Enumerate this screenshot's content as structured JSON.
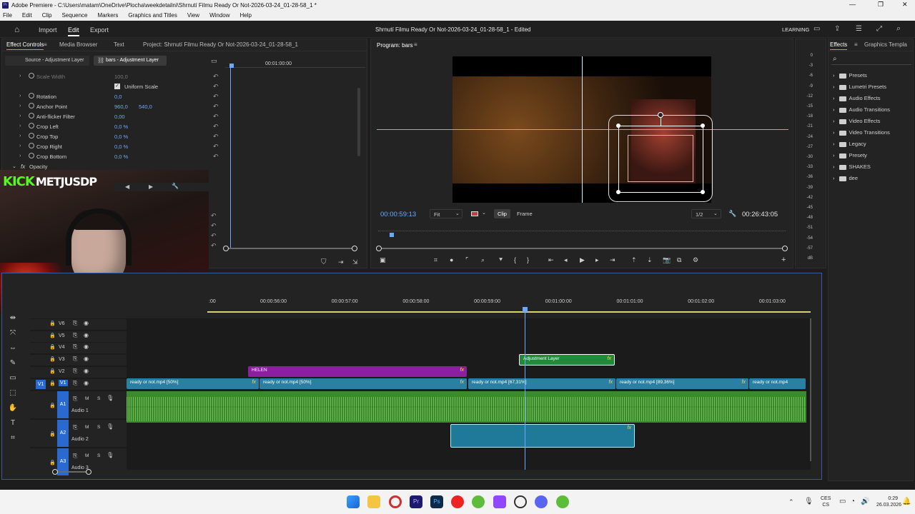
{
  "window": {
    "title": "Adobe Premiere - C:\\Users\\matam\\OneDrive\\Plocha\\weekdetailni\\Shrnutí Filmu Ready Or Not-2026-03-24_01-28-58_1 *"
  },
  "menu": [
    "File",
    "Edit",
    "Clip",
    "Sequence",
    "Markers",
    "Graphics and Titles",
    "View",
    "Window",
    "Help"
  ],
  "workspace": {
    "tabs": [
      "Import",
      "Edit",
      "Export"
    ],
    "active_tab": "Edit",
    "project_title": "Shrnutí Filmu Ready Or Not-2026-03-24_01-28-58_1",
    "edited": "- Edited",
    "learning": "LEARNING"
  },
  "effect_controls": {
    "tabs": [
      "Effect Controls",
      "Media Browser",
      "Text",
      "Project: Shrnutí Filmu Ready Or Not-2026-03-24_01-28-58_1"
    ],
    "source_label": "Source - Adjustment Layer",
    "clip_label": "bars - Adjustment Layer",
    "timecode": "00:01:00:00",
    "properties": [
      {
        "name": "Scale Width",
        "v1": "100,0",
        "v2": "",
        "dim": true
      },
      {
        "name": "Uniform Scale",
        "v1": "",
        "v2": "",
        "checkbox": true
      },
      {
        "name": "Rotation",
        "v1": "0,0",
        "v2": ""
      },
      {
        "name": "Anchor Point",
        "v1": "960,0",
        "v2": "540,0"
      },
      {
        "name": "Anti-flicker Filter",
        "v1": "0,00",
        "v2": ""
      },
      {
        "name": "Crop Left",
        "v1": "0,0 %",
        "v2": ""
      },
      {
        "name": "Crop Top",
        "v1": "0,0 %",
        "v2": ""
      },
      {
        "name": "Crop Right",
        "v1": "0,0 %",
        "v2": ""
      },
      {
        "name": "Crop Bottom",
        "v1": "0,0 %",
        "v2": ""
      }
    ],
    "opacity_label": "Opacity"
  },
  "overlay": {
    "kick_text": "KICK",
    "channel": "METJUSDP"
  },
  "program_monitor": {
    "title": "Program: bars",
    "current_tc": "00:00:59:13",
    "fit": "Fit",
    "clip_btn": "Clip",
    "frame_btn": "Frame",
    "resolution": "1/2",
    "duration_tc": "00:26:43:05"
  },
  "audio_meter": {
    "labels": [
      "0",
      "-3",
      "-6",
      "-9",
      "-12",
      "-15",
      "-18",
      "-21",
      "-24",
      "-27",
      "-30",
      "-33",
      "-36",
      "-39",
      "-42",
      "-45",
      "-48",
      "-51",
      "-54",
      "-57",
      "dB"
    ]
  },
  "effects_panel": {
    "tabs": [
      "Effects",
      "Graphics Templa"
    ],
    "items": [
      "Presets",
      "Lumetri Presets",
      "Audio Effects",
      "Audio Transitions",
      "Video Effects",
      "Video Transitions",
      "Legacy",
      "Presety",
      "SHAKES",
      "dee"
    ]
  },
  "timeline": {
    "ruler": [
      "00:00:56:00",
      "00:00:57:00",
      "00:00:58:00",
      "00:00:59:00",
      "00:01:00:00",
      "00:01:01:00",
      "00:01:02:00",
      "00:01:03:00"
    ],
    "ruler_start": ":00",
    "video_tracks": [
      "V6",
      "V5",
      "V4",
      "V3",
      "V2",
      "V1"
    ],
    "audio_tracks": [
      {
        "id": "A1",
        "name": "Audio 1"
      },
      {
        "id": "A2",
        "name": "Audio 2"
      },
      {
        "id": "A3",
        "name": "Audio 3"
      }
    ],
    "track_btn_m": "M",
    "track_btn_s": "S",
    "source_patch": "V1",
    "clips": {
      "adjustment": "Adjustment Layer",
      "helen": "HELEN",
      "v1": [
        "ready or not.mp4 [50%]",
        "ready or not.mp4 [50%]",
        "ready or not.mp4 [67,31%]",
        "ready or not.mp4 [89,36%]",
        "ready or not.mp4"
      ],
      "fx": "fx"
    }
  },
  "taskbar": {
    "lang1": "CES",
    "lang2": "CS",
    "time": "0:29",
    "date": "26.03.2026"
  },
  "colors": {
    "accent": "#6aa8ff",
    "v1_clip": "#2b7fa3",
    "helen_clip": "#8c1fa0",
    "adjustment_clip": "#1f8a3a",
    "audio_clip": "#3a8c2a",
    "playhead": "#6aa8ff"
  }
}
